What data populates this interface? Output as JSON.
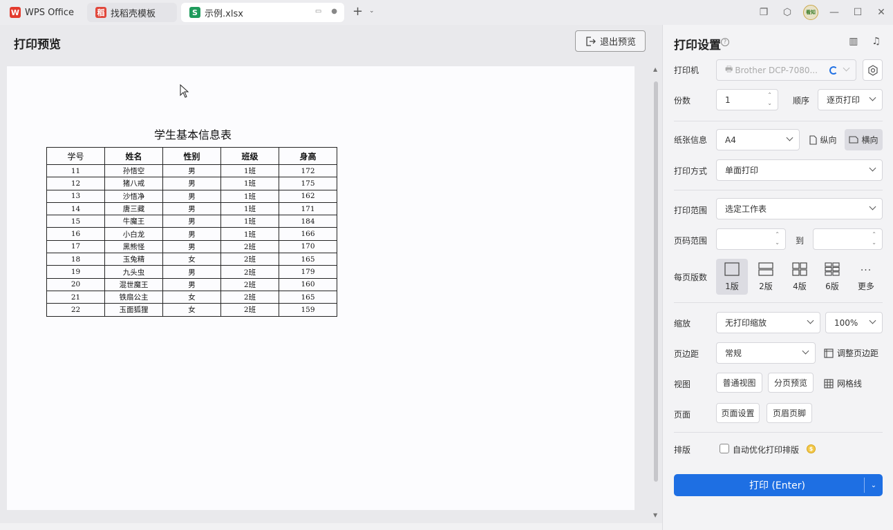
{
  "tabs": [
    {
      "label": "WPS Office",
      "icon": "wps-logo-icon",
      "color": "#e33b2e"
    },
    {
      "label": "找稻壳模板",
      "icon": "docer-icon",
      "color": "#e0463a"
    },
    {
      "label": "示例.xlsx",
      "icon": "spreadsheet-icon",
      "icon_text": "S",
      "color": "#1f9b5c"
    }
  ],
  "avatar_text": "看知",
  "preview": {
    "title": "打印预览",
    "exit_label": "退出预览",
    "sheet_title": "学生基本信息表",
    "columns": [
      "学号",
      "姓名",
      "性别",
      "班级",
      "身高"
    ],
    "rows": [
      [
        "11",
        "孙悟空",
        "男",
        "1班",
        "172"
      ],
      [
        "12",
        "猪八戒",
        "男",
        "1班",
        "175"
      ],
      [
        "13",
        "沙悟净",
        "男",
        "1班",
        "162"
      ],
      [
        "14",
        "唐三藏",
        "男",
        "1班",
        "171"
      ],
      [
        "15",
        "牛魔王",
        "男",
        "1班",
        "184"
      ],
      [
        "16",
        "小白龙",
        "男",
        "1班",
        "166"
      ],
      [
        "17",
        "黑熊怪",
        "男",
        "2班",
        "170"
      ],
      [
        "18",
        "玉兔精",
        "女",
        "2班",
        "165"
      ],
      [
        "19",
        "九头虫",
        "男",
        "2班",
        "179"
      ],
      [
        "20",
        "混世魔王",
        "男",
        "2班",
        "160"
      ],
      [
        "21",
        "铁扇公主",
        "女",
        "2班",
        "165"
      ],
      [
        "22",
        "玉面狐狸",
        "女",
        "2班",
        "159"
      ]
    ]
  },
  "settings": {
    "title": "打印设置",
    "printer_label": "打印机",
    "printer_value": "Brother DCP-7080...",
    "copies_label": "份数",
    "copies_value": "1",
    "order_label": "顺序",
    "order_value": "逐页打印",
    "paper_label": "纸张信息",
    "paper_value": "A4",
    "portrait_label": "纵向",
    "landscape_label": "横向",
    "print_mode_label": "打印方式",
    "print_mode_value": "单面打印",
    "range_label": "打印范围",
    "range_value": "选定工作表",
    "page_range_label": "页码范围",
    "page_range_to": "到",
    "per_page_label": "每页版数",
    "per_page_options": [
      "1版",
      "2版",
      "4版",
      "6版",
      "更多"
    ],
    "scale_label": "缩放",
    "scale_value": "无打印缩放",
    "zoom_value": "100%",
    "margin_label": "页边距",
    "margin_value": "常规",
    "adjust_margin_label": "调整页边距",
    "view_label": "视图",
    "normal_view_label": "普通视图",
    "page_break_view_label": "分页预览",
    "gridline_label": "网格线",
    "page_label": "页面",
    "page_setup_label": "页面设置",
    "header_footer_label": "页眉页脚",
    "layout_label": "排版",
    "auto_optimize_label": "自动优化打印排版",
    "print_button_label": "打印 (Enter)"
  },
  "colors": {
    "accent": "#1e6fe3",
    "sheet_green": "#1f9b5c"
  }
}
